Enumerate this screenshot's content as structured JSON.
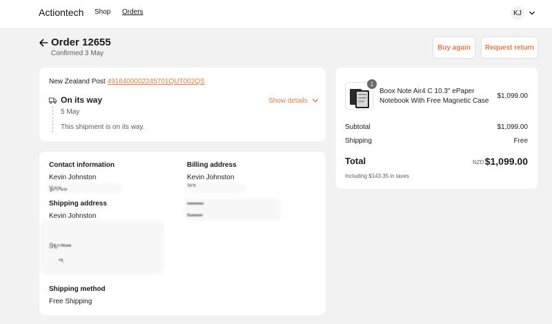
{
  "header": {
    "brand": "Actiontech",
    "nav": {
      "shop": "Shop",
      "orders": "Orders"
    },
    "account_initials": "KJ"
  },
  "order": {
    "title": "Order 12655",
    "confirmed": "Confirmed 3 May",
    "buy_again": "Buy again",
    "request_return": "Request return"
  },
  "shipment": {
    "carrier": "New Zealand Post",
    "tracking_number": "4916400002245701QUT002QS",
    "status": "On its way",
    "show_details": "Show details",
    "date": "5 May",
    "note": "This shipment is on its way."
  },
  "info": {
    "contact_heading": "Contact information",
    "contact_name": "Kevin Johnston",
    "billing_heading": "Billing address",
    "billing_name": "Kevin Johnston",
    "shipping_heading": "Shipping address",
    "shipping_name": "Kevin Johnston",
    "method_heading": "Shipping method",
    "method_value": "Free Shipping"
  },
  "summary": {
    "item": {
      "quantity": "1",
      "name": "Boox Note Air4 C 10.3\" ePaper Notebook With Free Magnetic Case",
      "price": "$1,099.00"
    },
    "subtotal_label": "Subtotal",
    "subtotal_value": "$1,099.00",
    "shipping_label": "Shipping",
    "shipping_value": "Free",
    "total_label": "Total",
    "currency": "NZD",
    "total_value": "$1,099.00",
    "taxes_note": "Including $143.35 in taxes"
  },
  "colors": {
    "accent": "#e07a45",
    "page_background": "#f2f2f2",
    "card_background": "#ffffff",
    "muted_text": "#5c5c5c"
  },
  "icons": {
    "back": "arrow-left-icon",
    "account_menu": "chevron-down-icon",
    "shipment": "truck-icon",
    "show_details": "chevron-down-icon"
  }
}
